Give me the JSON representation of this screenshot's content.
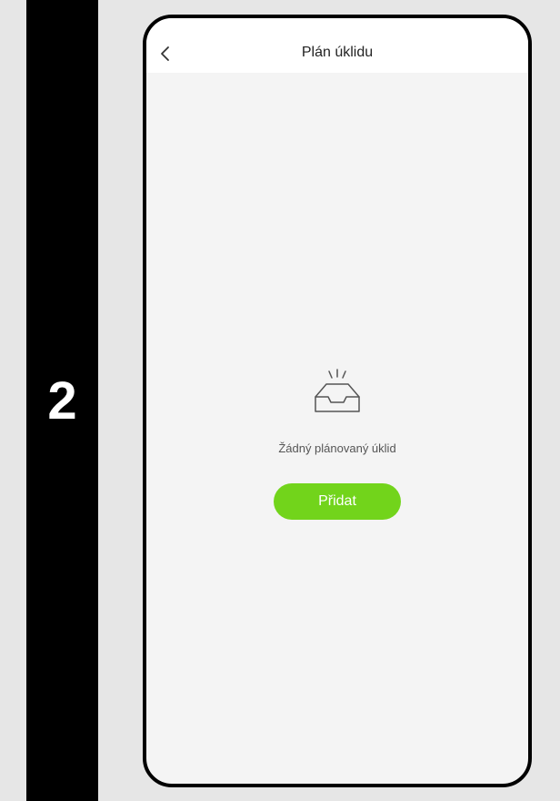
{
  "step": {
    "number": "2"
  },
  "header": {
    "title": "Plán úklidu",
    "back_icon": "chevron-left-icon"
  },
  "empty_state": {
    "icon": "empty-tray-icon",
    "message": "Žádný plánovaný úklid"
  },
  "actions": {
    "add_label": "Přidat"
  },
  "colors": {
    "accent": "#72d41b",
    "step_bar": "#000000",
    "page_background": "#e6e6e6",
    "screen_background": "#f4f4f4",
    "header_background": "#ffffff"
  }
}
